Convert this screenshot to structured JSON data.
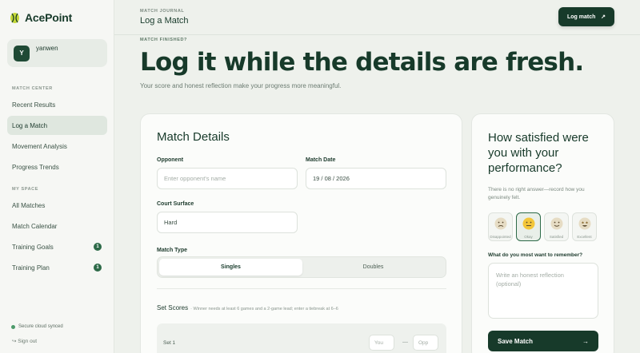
{
  "app": {
    "name": "AcePoint"
  },
  "user": {
    "initial": "Y",
    "name": "yanwen"
  },
  "sidebar": {
    "sections": [
      "MATCH CENTER",
      "MY SPACE"
    ],
    "match_center": [
      {
        "label": "Recent Results"
      },
      {
        "label": "Log a Match"
      },
      {
        "label": "Movement Analysis"
      },
      {
        "label": "Progress Trends"
      }
    ],
    "my_space": [
      {
        "label": "All Matches"
      },
      {
        "label": "Match Calendar"
      },
      {
        "label": "Training Goals",
        "badge": "1"
      },
      {
        "label": "Training Plan",
        "badge": "1"
      }
    ],
    "status": "Secure cloud synced",
    "signout": "Sign out"
  },
  "header": {
    "breadcrumb": "MATCH JOURNAL",
    "title": "Log a Match",
    "button": "Log match",
    "button_icon": "↗"
  },
  "hero": {
    "eyebrow": "MATCH FINISHED?",
    "title": "Log it while the details are fresh.",
    "subtitle": "Your score and honest reflection make your progress more meaningful."
  },
  "match_details": {
    "title": "Match Details",
    "opponent_label": "Opponent",
    "opponent_placeholder": "Enter opponent's name",
    "date_label": "Match Date",
    "date_value": "19 / 08 / 2026",
    "surface_label": "Court Surface",
    "surface_value": "Hard",
    "type_label": "Match Type",
    "type_options": [
      "Singles",
      "Doubles"
    ],
    "set_scores_label": "Set Scores",
    "set_scores_hint": "· Winner needs at least 6 games and a 2-game lead; enter a tiebreak at 6–6",
    "set_label": "Set 1",
    "score_you": "You",
    "score_opp": "Opp",
    "score_sep": "—"
  },
  "satisfaction": {
    "title": "How satisfied were you with your performance?",
    "hint": "There is no right answer—record how you genuinely felt.",
    "options": [
      "Disappointed",
      "Okay",
      "Satisfied",
      "Excellent"
    ],
    "selected": "Okay",
    "remember_label": "What do you most want to remember?",
    "remember_placeholder": "Write an honest reflection (optional)",
    "save_button": "Save Match",
    "save_icon": "→"
  },
  "colors": {
    "accent": "#173a2a",
    "brand_green": "#2d6a48",
    "background": "#eef1ec"
  }
}
